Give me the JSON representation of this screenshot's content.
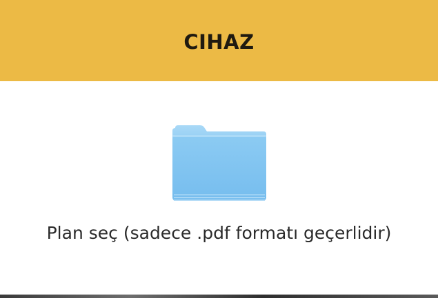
{
  "header": {
    "title": "CIHAZ",
    "background_color": "#ecba45"
  },
  "upload": {
    "icon": "folder-icon",
    "label": "Plan seç (sadece .pdf formatı geçerlidir)"
  }
}
